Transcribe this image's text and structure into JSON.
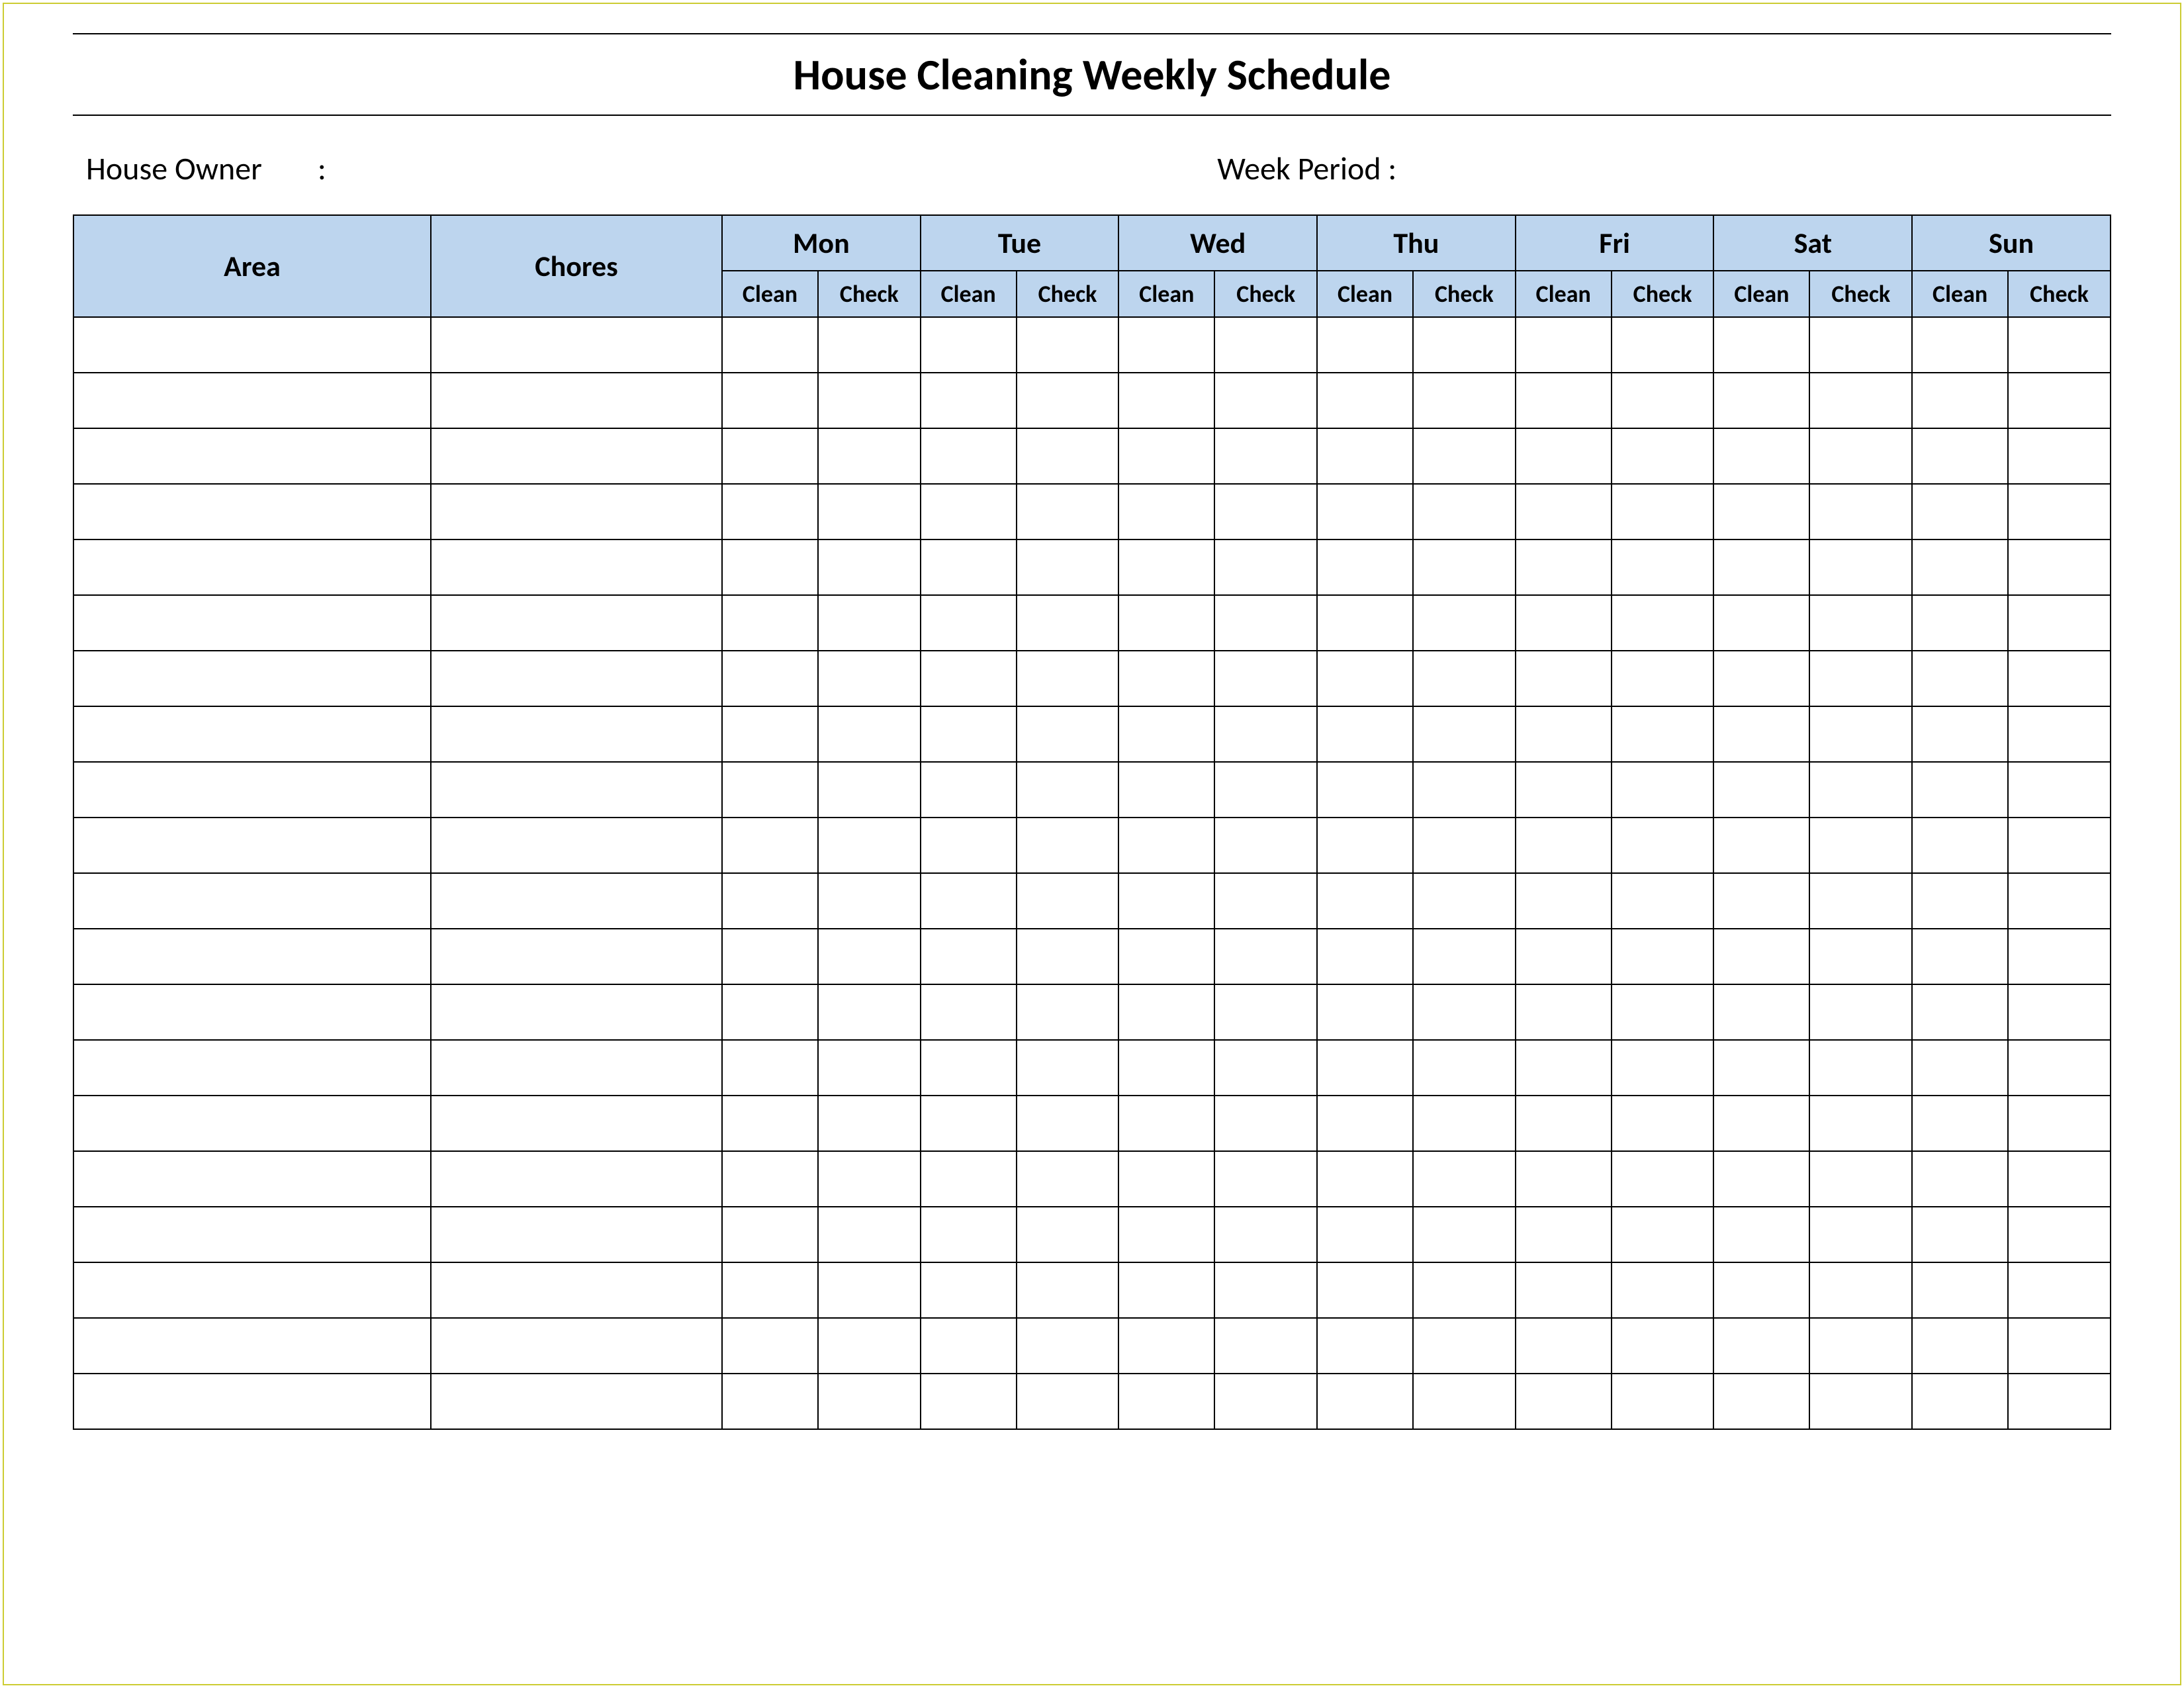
{
  "title": "House Cleaning Weekly Schedule",
  "meta": {
    "owner_label": "House Owner",
    "owner_separator": ":",
    "period_label": "Week  Period :"
  },
  "headers": {
    "area": "Area",
    "chores": "Chores",
    "days": [
      "Mon",
      "Tue",
      "Wed",
      "Thu",
      "Fri",
      "Sat",
      "Sun"
    ],
    "sub": {
      "clean": "Clean",
      "check": "Check"
    }
  },
  "row_count": 20,
  "colors": {
    "header_bg": "#bdd5ee",
    "border_frame": "#cccc33"
  }
}
